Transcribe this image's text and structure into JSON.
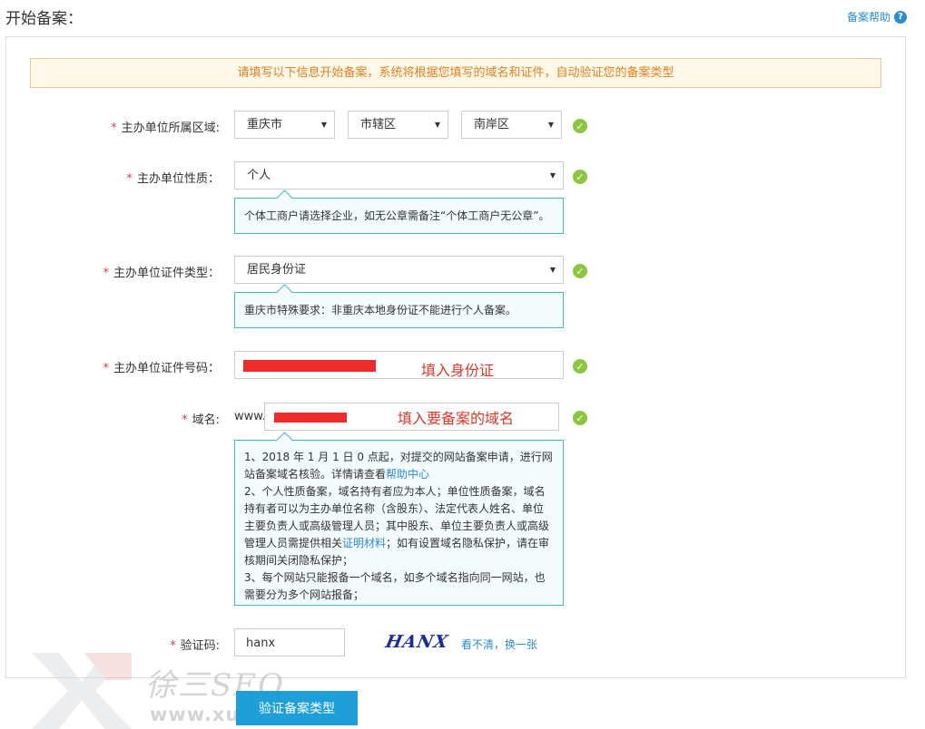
{
  "header": {
    "title": "开始备案：",
    "help_label": "备案帮助",
    "help_icon": "question-icon"
  },
  "notice": "请填写以下信息开始备案，系统将根据您填写的域名和证件，自动验证您的备案类型",
  "form": {
    "region": {
      "label": "主办单位所属区域:",
      "province": "重庆市",
      "city": "市辖区",
      "district": "南岸区"
    },
    "nature": {
      "label": "主办单位性质：",
      "value": "个人",
      "tip": "个体工商户请选择企业，如无公章需备注“个体工商户无公章”。"
    },
    "cert_type": {
      "label": "主办单位证件类型：",
      "value": "居民身份证",
      "tip": "重庆市特殊要求：非重庆本地身份证不能进行个人备案。"
    },
    "cert_no": {
      "label": "主办单位证件号码：",
      "annotation": "填入身份证"
    },
    "domain": {
      "label": "域名:",
      "prefix": "www.",
      "annotation": "填入要备案的域名",
      "tip_1a": "1、2018 年 1 月 1 日 0 点起，对提交的网站备案申请，进行网站备案域名核验。详情请查看",
      "tip_1_link": "帮助中心",
      "tip_2a": "2、个人性质备案，域名持有者应为本人；单位性质备案，域名持有者可以为主办单位名称（含股东）、法定代表人姓名、单位主要负责人或高级管理人员；其中股东、单位主要负责人或高级管理人员需提供相关",
      "tip_2_link": "证明材料",
      "tip_2b": "；如有设置域名隐私保护，请在审核期间关闭隐私保护；",
      "tip_3": "3、每个网站只能报备一个域名，如多个域名指向同一网站，也需要分为多个网站报备；"
    },
    "captcha": {
      "label": "验证码:",
      "value": "hanx",
      "image_text": "HANX",
      "refresh_label": "看不清，换一张"
    },
    "required_mark": "*",
    "submit_label": "验证备案类型"
  },
  "watermark": {
    "name": "徐三SEO",
    "url": "www.xusseo.com"
  },
  "colors": {
    "accent": "#1e9fd7",
    "check": "#8cc63f",
    "required": "#e4393c",
    "notice_text": "#e08020",
    "tip_border": "#3fb8d2",
    "annotation": "#d83a2a"
  }
}
